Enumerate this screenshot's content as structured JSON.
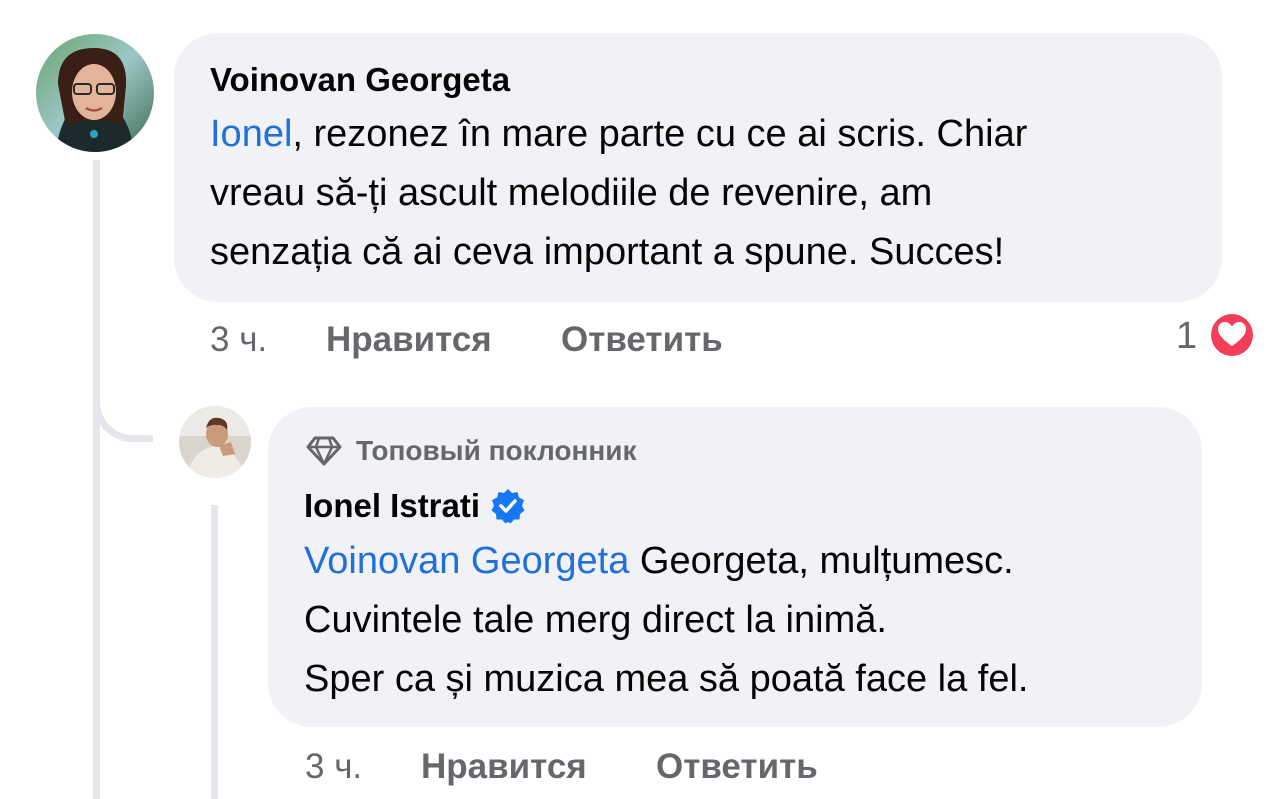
{
  "comment": {
    "author": "Voinovan Georgeta",
    "mention": "Ionel",
    "text_line1_rest": ", rezonez în mare parte cu ce ai scris. Chiar",
    "text_line2": "vreau să-ți ascult melodiile de revenire, am",
    "text_line3": "senzația că ai ceva important a spune. Succes!",
    "time": "3 ч.",
    "like_label": "Нравится",
    "reply_label": "Ответить",
    "reaction_count": "1",
    "reaction_icon": "heart-icon",
    "reaction_color": "#f33e58"
  },
  "reply": {
    "badge_icon": "diamond-icon",
    "badge_label": "Топовый поклонник",
    "author": "Ionel Istrati",
    "verified_icon": "verified-badge-icon",
    "verified_color": "#1877f2",
    "mention": "Voinovan Georgeta",
    "text_line1_rest": " Georgeta, mulțumesc.",
    "text_line2": "Cuvintele tale merg direct la inimă.",
    "text_line3": "Sper ca și muzica mea să poată face la fel.",
    "time": "3 ч.",
    "like_label": "Нравится",
    "reply_label": "Ответить"
  },
  "colors": {
    "bubble": "#f0f2f5",
    "mention": "#216fdb",
    "meta": "#65676b",
    "thread_line": "#e4e6eb"
  }
}
